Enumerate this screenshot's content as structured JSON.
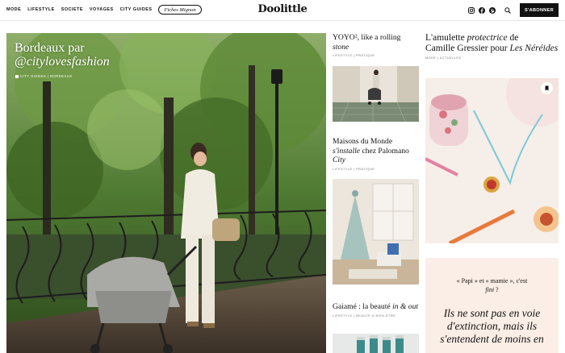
{
  "nav": {
    "items": [
      "MODE",
      "LIFESTYLE",
      "SOCIETE",
      "VOYAGES",
      "CITY GUIDES"
    ],
    "pill_label": "Fiches Mignon"
  },
  "brand": {
    "logo": "Doolittle"
  },
  "toolbar": {
    "icons": [
      "instagram-icon",
      "facebook-icon",
      "pinterest-icon",
      "search-icon"
    ],
    "subscribe_label": "S'ABONNER"
  },
  "hero": {
    "title_line1": "Bordeaux par",
    "title_line2": "@citylovesfashion",
    "category": "CITY GUIDES | BORDEAUX"
  },
  "articles": [
    {
      "title": "YOYO², like a rolling",
      "title_it": "stone",
      "category": "LIFESTYLE | PRATIQUE"
    },
    {
      "title_a": "Maisons du Monde",
      "title_b": "s'installe",
      "title_c": "chez Palomano",
      "title_d": "City",
      "category": "LIFESTYLE | PRATIQUE"
    },
    {
      "title_a": "Gaiamé : la beauté",
      "title_b": "in & out",
      "category": "LIFESTYLE | BEAUTÉ & BIEN-ÊTRE"
    }
  ],
  "feature": {
    "title_a": "L'amulette",
    "title_b": "protectrice",
    "title_c": "de",
    "title_d": "Camille Gressier pour",
    "title_e": "Les Néréides",
    "category": "MODE | ACTUELLES"
  },
  "quote": {
    "small_a": "« Papi » et « mamie », c'est",
    "small_b": "fini",
    "big": "Ils ne sont pas en voie d'extinction, mais ils s'entendent de moins en"
  },
  "colors": {
    "accent": "#111111",
    "quote_bg": "#fbeee6",
    "subscribe_bg": "#111111"
  }
}
